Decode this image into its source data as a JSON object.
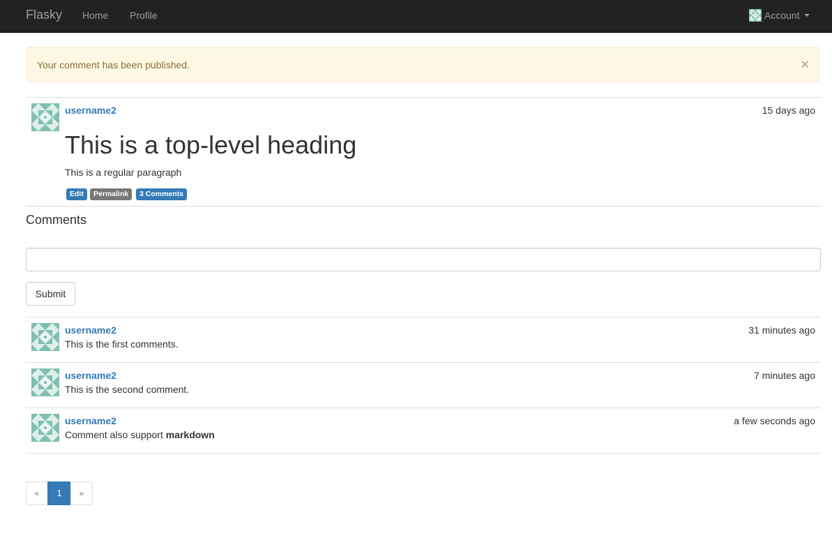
{
  "navbar": {
    "brand": "Flasky",
    "links": [
      "Home",
      "Profile"
    ],
    "account_label": "Account"
  },
  "alert": {
    "message": "Your comment has been published.",
    "close_symbol": "×"
  },
  "post": {
    "author": "username2",
    "timestamp": "15 days ago",
    "heading": "This is a top-level heading",
    "paragraph": "This is a regular paragraph",
    "actions": [
      "Edit",
      "Permalink",
      "3 Comments"
    ]
  },
  "comments_section": {
    "title": "Comments",
    "input_value": "",
    "submit_label": "Submit"
  },
  "comments": [
    {
      "author": "username2",
      "timestamp": "31 minutes ago",
      "text": "This is the first comments."
    },
    {
      "author": "username2",
      "timestamp": "7 minutes ago",
      "text": "This is the second comment."
    },
    {
      "author": "username2",
      "timestamp": "a few seconds ago",
      "text_prefix": "Comment also support ",
      "text_bold": "markdown"
    }
  ],
  "pagination": {
    "prev": "«",
    "current": "1",
    "next": "»"
  },
  "colors": {
    "navbar_bg": "#222222",
    "link_blue": "#337ab7",
    "alert_bg": "#fcf8e3",
    "alert_text": "#8a6d3b",
    "identicon_teal": "#7fbfb0",
    "label_grey": "#777777"
  }
}
